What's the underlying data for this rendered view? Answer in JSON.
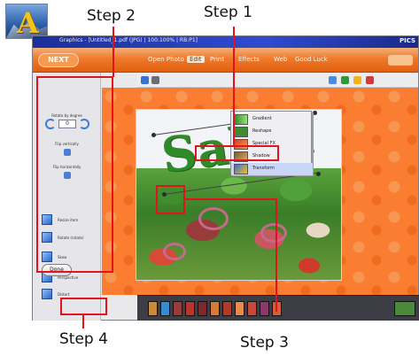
{
  "app": {
    "logo_letter": "A",
    "window_title": "Graphics - [Untitled_1.pdf (JPG) | 100:100% | RB:P1]",
    "title_corner": "PICS"
  },
  "menubar": {
    "next_label": "NEXT",
    "menus": [
      "Open Photo",
      "Edit",
      "Print",
      "Effects",
      "Web",
      "Good Luck"
    ]
  },
  "left_panel": {
    "rotate_heading": "Rotate by degree",
    "rotate_value": "0",
    "flip_vertical": "Flip vertically",
    "flip_horizontal": "Flip horizontally",
    "tools": [
      "Resize item",
      "Rotate (rotate)",
      "Skew",
      "Perspective",
      "Distort"
    ],
    "done_label": "Done"
  },
  "dropdown": {
    "items": [
      "Gradient",
      "Reshape",
      "Special FX",
      "Shadow",
      "Transform"
    ]
  },
  "canvas": {
    "salad_text": "Salad"
  },
  "annotations": {
    "step1": "Step 1",
    "step2": "Step 2",
    "step3": "Step 3",
    "step4": "Step 4",
    "highlight_color": "#e4131b"
  },
  "colors": {
    "canvas_bg": "#fb7d32",
    "menubar": "#ef7a2a",
    "titlebar": "#2f4bd0",
    "salad_green": "#2f8a2a"
  },
  "icons": [
    "app-logo-icon",
    "rotate-left-icon",
    "rotate-right-icon",
    "flip-vertical-icon",
    "flip-horizontal-icon",
    "resize-icon",
    "rotate-tool-icon",
    "skew-icon",
    "perspective-icon",
    "distort-icon"
  ]
}
